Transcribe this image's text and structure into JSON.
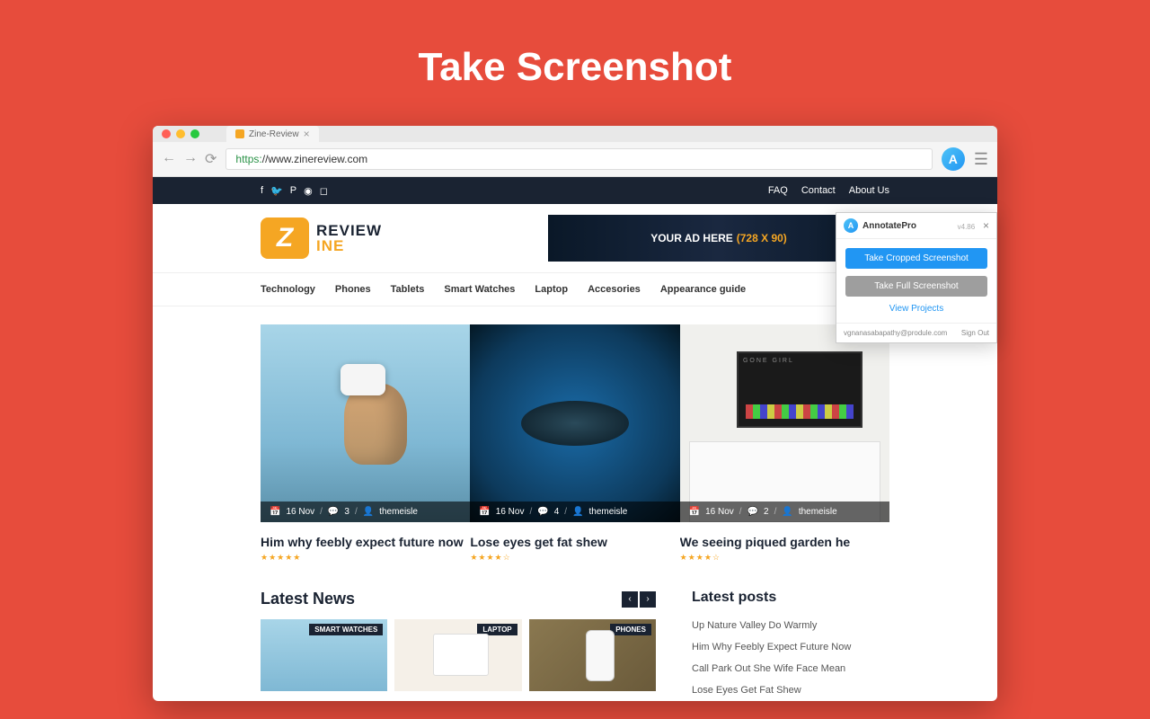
{
  "hero": "Take Screenshot",
  "browser": {
    "tab": "Zine-Review",
    "url_proto": "https:",
    "url_rest": "//www.zinereview.com"
  },
  "topbar": {
    "links": [
      "FAQ",
      "Contact",
      "About Us"
    ]
  },
  "logo": {
    "review": "REVIEW",
    "ine": "INE",
    "z": "Z"
  },
  "ad": {
    "text": "YOUR AD HERE",
    "dim": "(728 X 90)"
  },
  "nav": [
    "Technology",
    "Phones",
    "Tablets",
    "Smart Watches",
    "Laptop",
    "Accesories",
    "Appearance guide"
  ],
  "cards": [
    {
      "date": "16 Nov",
      "comments": "3",
      "author": "themeisle",
      "title": "Him why feebly expect future now",
      "stars": "★★★★★"
    },
    {
      "date": "16 Nov",
      "comments": "4",
      "author": "themeisle",
      "title": "Lose eyes get fat shew",
      "stars": "★★★★☆"
    },
    {
      "date": "16 Nov",
      "comments": "2",
      "author": "themeisle",
      "title": "We seeing piqued garden he",
      "stars": "★★★★☆"
    }
  ],
  "latest_news": {
    "title": "Latest News",
    "items": [
      {
        "badge": "SMART WATCHES"
      },
      {
        "badge": "LAPTOP"
      },
      {
        "badge": "PHONES"
      }
    ]
  },
  "latest_posts": {
    "title": "Latest posts",
    "items": [
      "Up Nature Valley Do Warmly",
      "Him Why Feebly Expect Future Now",
      "Call Park Out She Wife Face Mean",
      "Lose Eyes Get Fat Shew"
    ]
  },
  "popup": {
    "name": "AnnotatePro",
    "version": "v4.86",
    "btn1": "Take Cropped Screenshot",
    "btn2": "Take Full Screenshot",
    "link": "View Projects",
    "email": "vgnanasabapathy@produle.com",
    "signout": "Sign Out"
  }
}
